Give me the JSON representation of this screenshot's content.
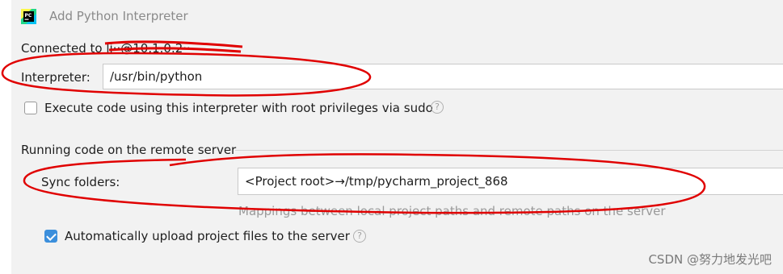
{
  "window": {
    "title": "Add Python Interpreter",
    "app_icon_text": "PC"
  },
  "connection": {
    "prefix": "Connected to",
    "host": "li··@10.1.0.2··"
  },
  "interpreter": {
    "label": "Interpreter:",
    "value": "/usr/bin/python"
  },
  "sudo": {
    "label": "Execute code using this interpreter with root privileges via sudo",
    "checked": false
  },
  "remote_section": {
    "title": "Running code on the remote server",
    "sync_label": "Sync folders:",
    "sync_value": "<Project root>→/tmp/pycharm_project_868",
    "hint": "Mappings between local project paths and remote paths on the server"
  },
  "auto_upload": {
    "label": "Automatically upload project files to the server",
    "checked": true
  },
  "help_glyph": "?",
  "watermark": "CSDN @努力地发光吧",
  "colors": {
    "checkbox_checked": "#3c8fdc",
    "annotation_red": "#e00000"
  }
}
